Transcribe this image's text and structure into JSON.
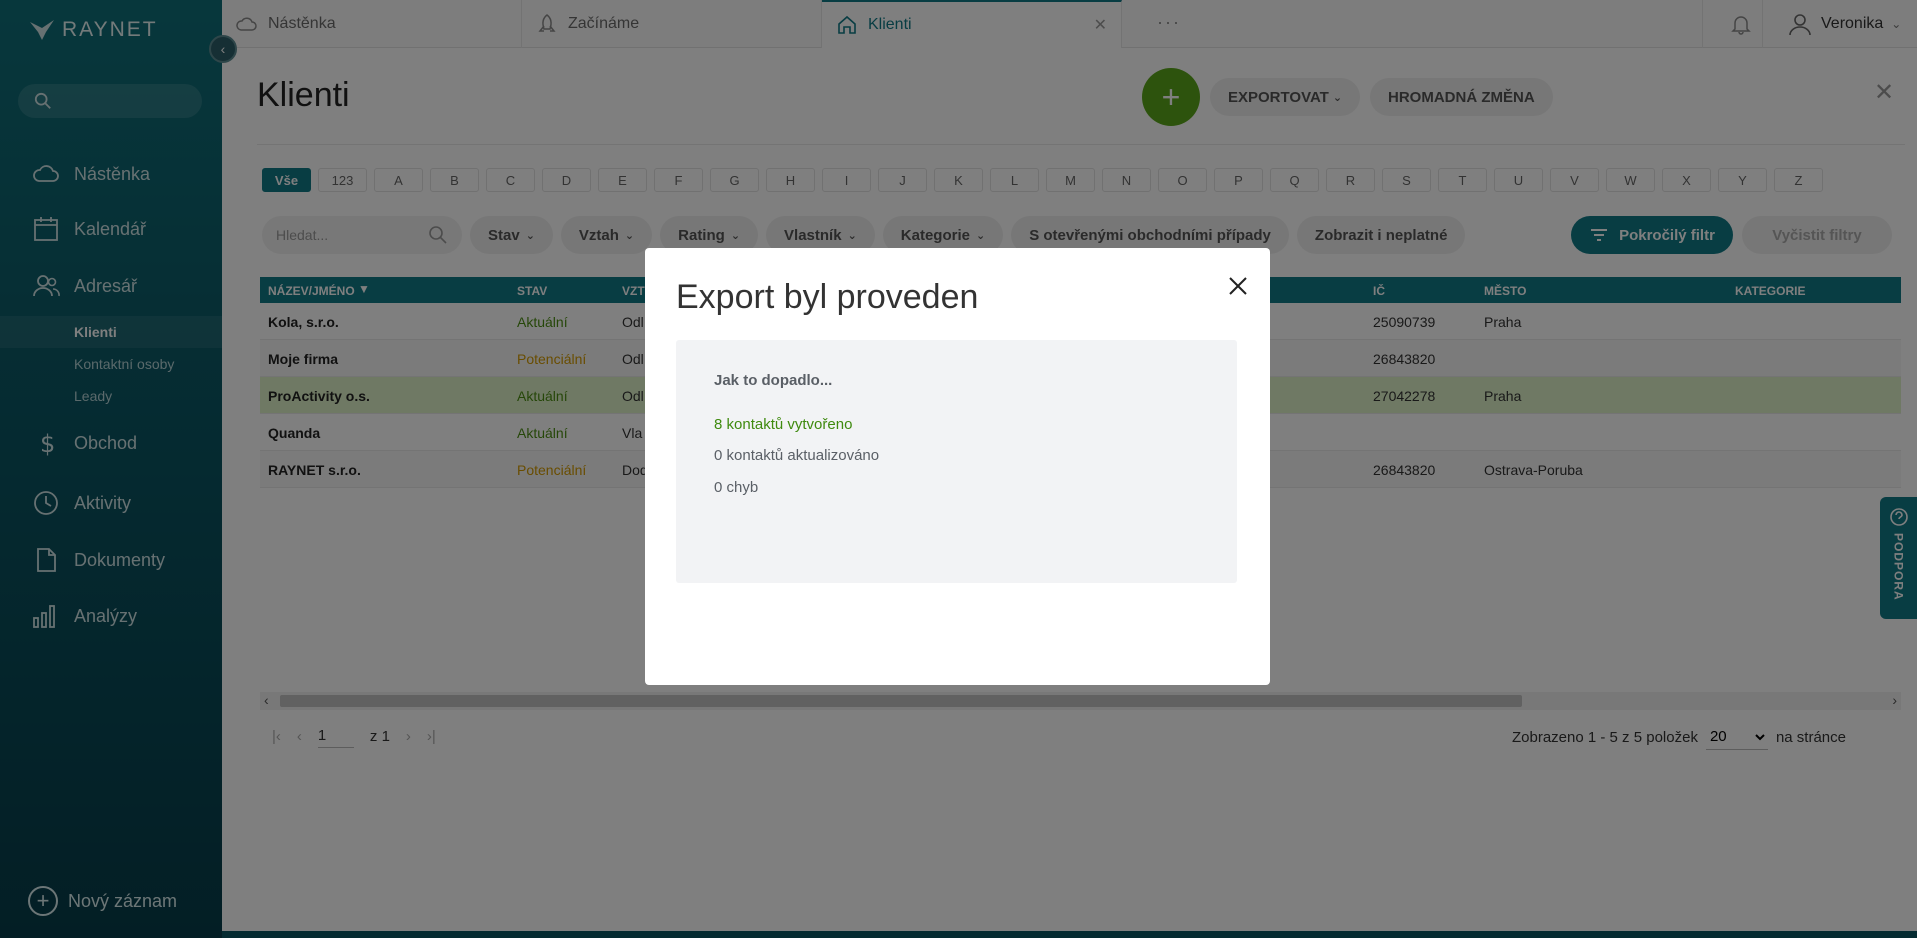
{
  "brand": {
    "name": "RAYNET"
  },
  "sidebar": {
    "search_placeholder": "",
    "items": [
      {
        "label": "Nástěnka",
        "icon": "cloud-icon"
      },
      {
        "label": "Kalendář",
        "icon": "calendar-icon"
      },
      {
        "label": "Adresář",
        "icon": "contacts-icon"
      },
      {
        "label": "Obchod",
        "icon": "dollar-icon"
      },
      {
        "label": "Aktivity",
        "icon": "clock-icon"
      },
      {
        "label": "Dokumenty",
        "icon": "document-icon"
      },
      {
        "label": "Analýzy",
        "icon": "chart-icon"
      }
    ],
    "sub_items": [
      {
        "label": "Klienti",
        "active": true
      },
      {
        "label": "Kontaktní osoby"
      },
      {
        "label": "Leady"
      }
    ],
    "new_record": "Nový záznam"
  },
  "tabs": [
    {
      "label": "Nástěnka"
    },
    {
      "label": "Začínáme"
    },
    {
      "label": "Klienti",
      "active": true
    }
  ],
  "tabs_more": "···",
  "user": {
    "name": "Veronika"
  },
  "page": {
    "title": "Klienti",
    "add_symbol": "+",
    "export_label": "EXPORTOVAT",
    "bulk_label": "HROMADNÁ ZMĚNA",
    "close_symbol": "✕"
  },
  "letters": [
    "Vše",
    "123",
    "A",
    "B",
    "C",
    "D",
    "E",
    "F",
    "G",
    "H",
    "I",
    "J",
    "K",
    "L",
    "M",
    "N",
    "O",
    "P",
    "Q",
    "R",
    "S",
    "T",
    "U",
    "V",
    "W",
    "X",
    "Y",
    "Z"
  ],
  "filters": {
    "search_placeholder": "Hledat...",
    "items": [
      "Stav",
      "Vztah",
      "Rating",
      "Vlastník",
      "Kategorie"
    ],
    "open_cases": "S otevřenými obchodními případy",
    "show_invalid": "Zobrazit i neplatné",
    "advanced": "Pokročilý filtr",
    "clear": "Vyčistit filtry"
  },
  "table": {
    "columns": {
      "name": "NÁZEV/JMÉNO",
      "state": "STAV",
      "relation": "VZT",
      "ic": "IČ",
      "city": "MĚSTO",
      "category": "KATEGORIE"
    },
    "rows": [
      {
        "name": "Kola, s.r.o.",
        "state": "Aktuální",
        "relation": "Odl",
        "ic": "25090739",
        "city": "Praha"
      },
      {
        "name": "Moje firma",
        "state": "Potenciální",
        "relation": "Odl",
        "ic": "26843820",
        "city": ""
      },
      {
        "name": "ProActivity o.s.",
        "state": "Aktuální",
        "relation": "Odl",
        "ic": "27042278",
        "city": "Praha"
      },
      {
        "name": "Quanda",
        "state": "Aktuální",
        "relation": "Vla",
        "ic": "",
        "city": ""
      },
      {
        "name": "RAYNET s.r.o.",
        "state": "Potenciální",
        "relation": "Dod",
        "ic": "26843820",
        "city": "Ostrava-Poruba"
      }
    ]
  },
  "pager": {
    "page": "1",
    "of": "z 1",
    "shown": "Zobrazeno 1 - 5 z 5 položek",
    "per_page": "20",
    "per_page_suffix": "na stránce"
  },
  "support": {
    "label": "PODPORA"
  },
  "modal": {
    "title": "Export byl proveden",
    "heading": "Jak to dopadlo...",
    "created": "8 kontaktů vytvořeno",
    "updated": "0 kontaktů aktualizováno",
    "errors": "0 chyb"
  },
  "colors": {
    "primary": "#117a87",
    "success": "#5aa61a",
    "warning": "#d39a00"
  }
}
